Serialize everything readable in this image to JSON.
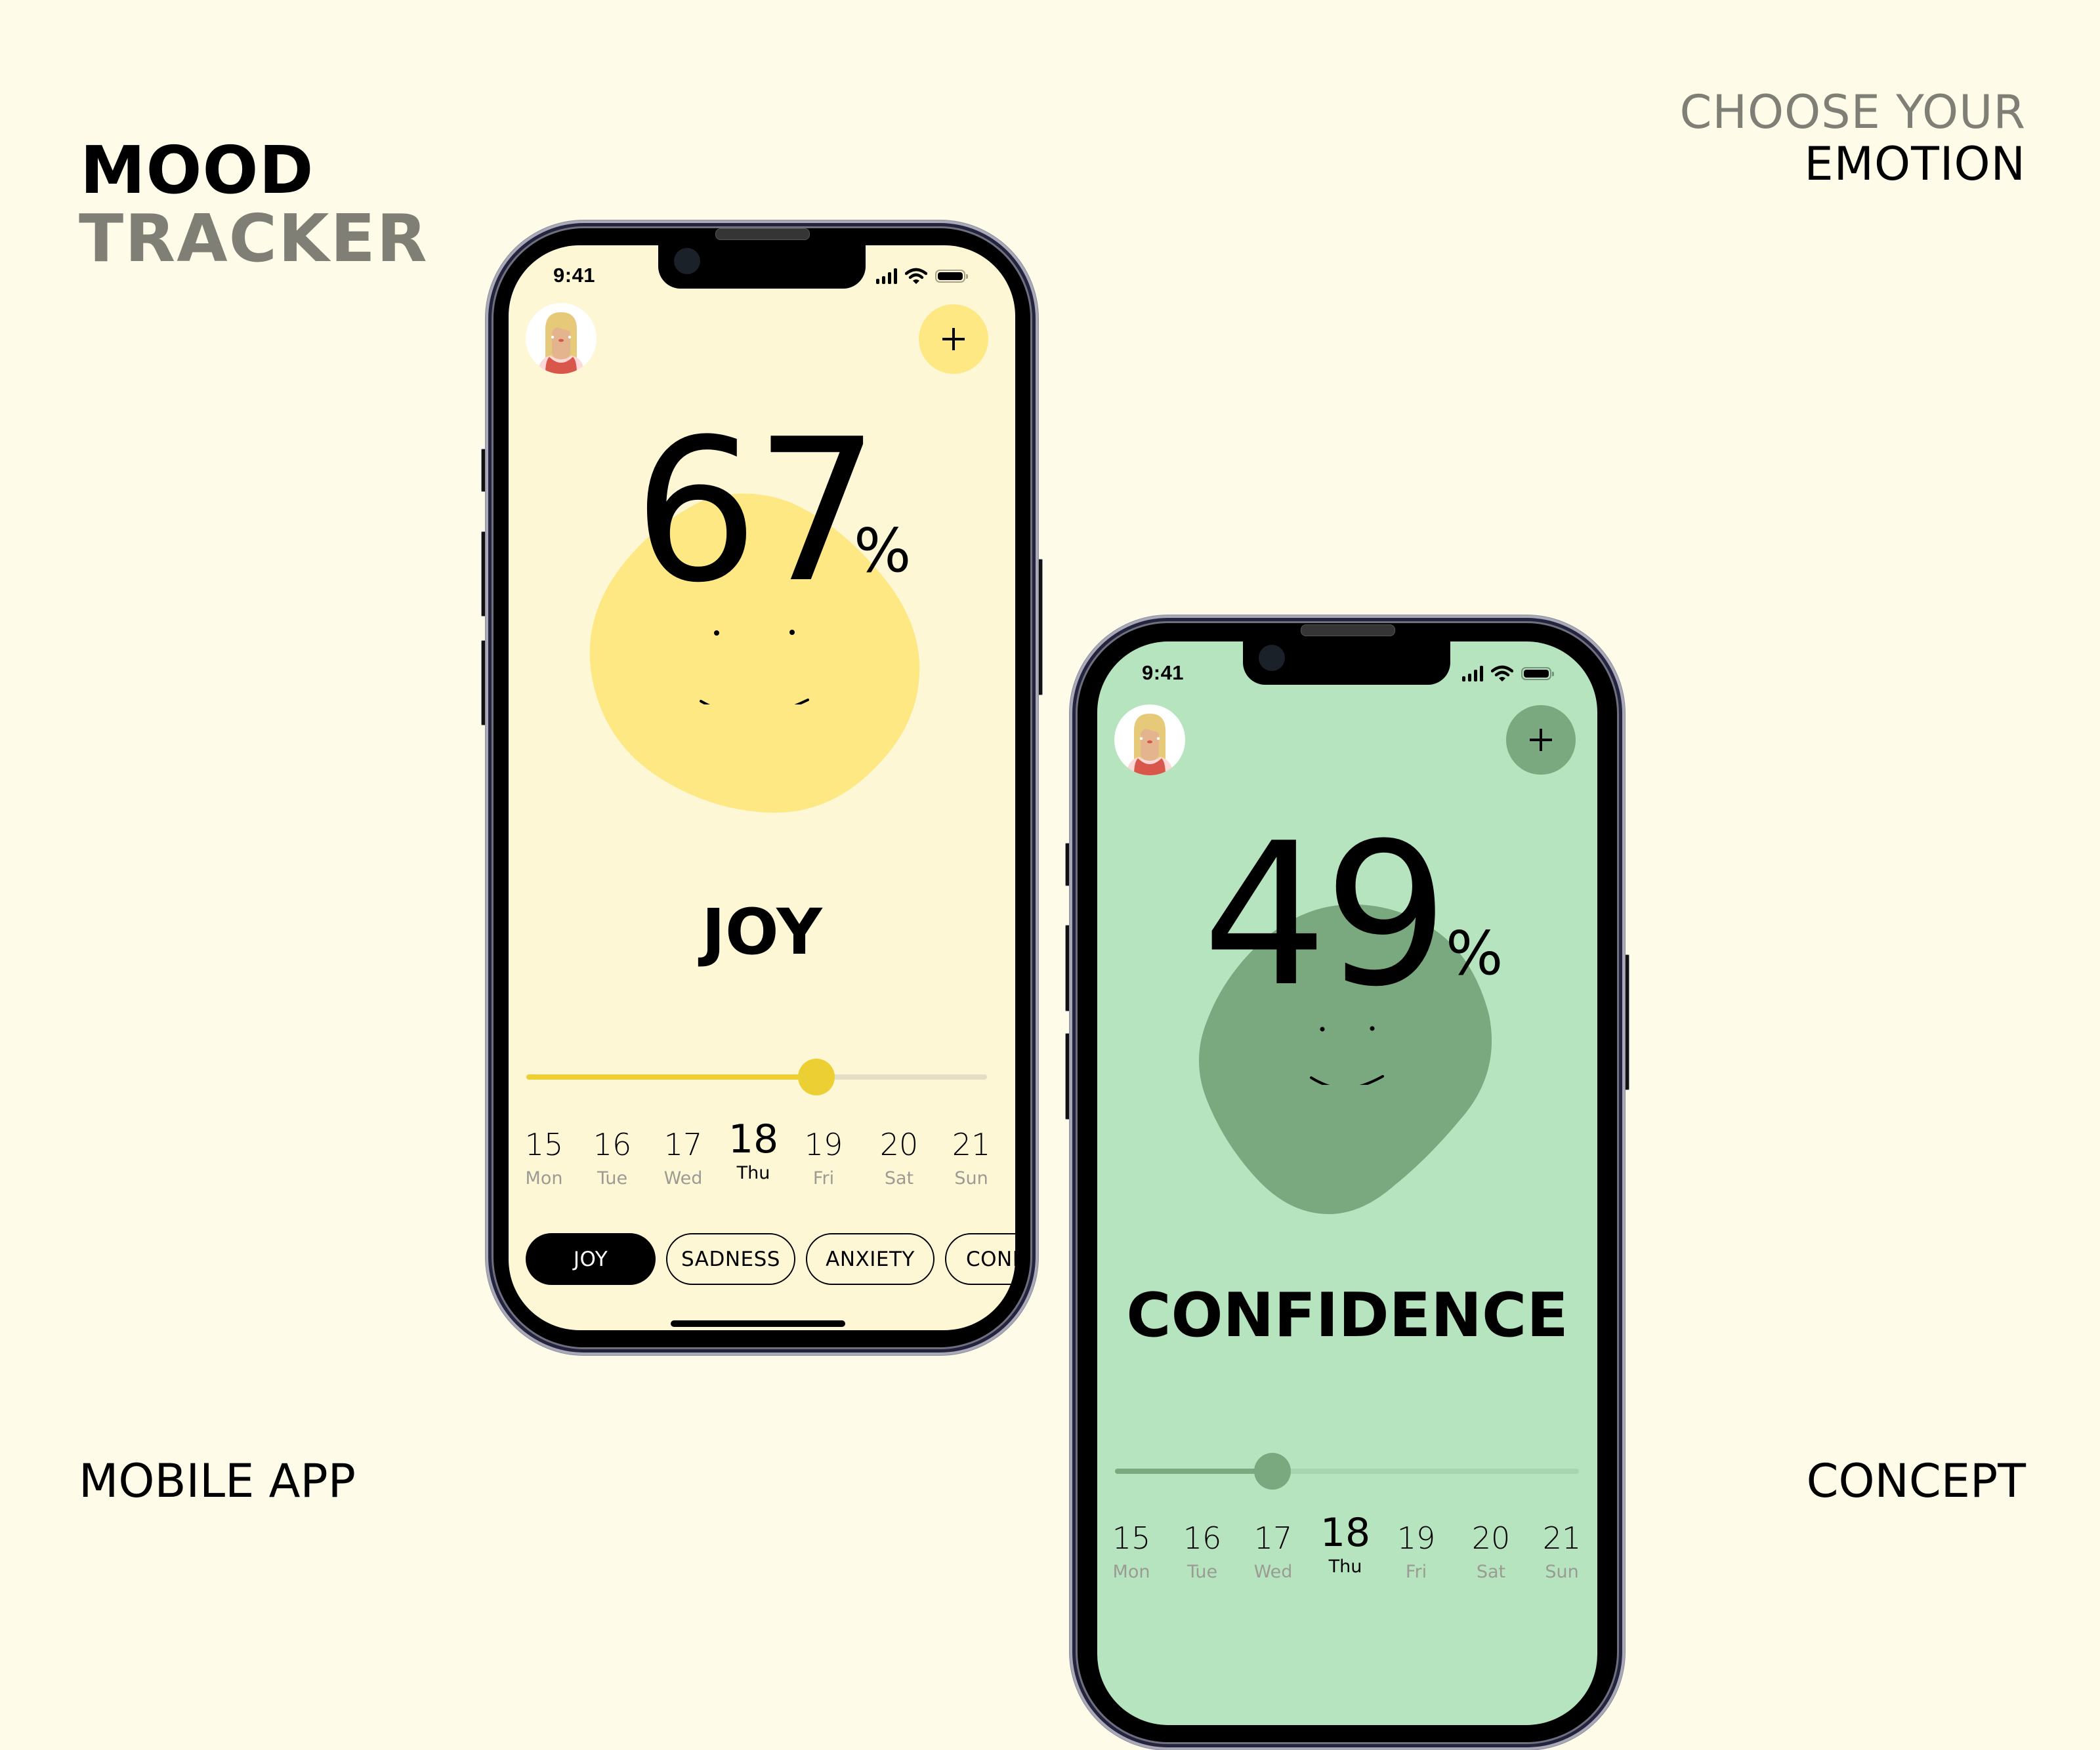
{
  "header": {
    "title_line1": "MOOD",
    "title_line2": "TRACKER",
    "tagline_line1": "CHOOSE YOUR",
    "tagline_line2": "EMOTION"
  },
  "footer": {
    "left": "MOBILE APP",
    "right": "CONCEPT"
  },
  "colors": {
    "background": "#fefbe9",
    "muted_text": "#7f7f76",
    "joy_screen": "#fef7d6",
    "joy_blob": "#fde884",
    "joy_accent": "#ecd033",
    "joy_track": "#e4dec4",
    "confidence_screen": "#b5e4bf",
    "confidence_blob": "#7aa87f",
    "confidence_accent": "#7aa87f",
    "confidence_track": "#a9d4b2"
  },
  "phones": [
    {
      "status": {
        "time": "9:41",
        "icons": [
          "signal-icon",
          "wifi-icon",
          "battery-icon"
        ]
      },
      "avatar_icon": "user-avatar",
      "add_icon": "plus-icon",
      "percentage": "67",
      "percent_sign": "%",
      "emotion": "JOY",
      "slider_value": 0.63,
      "dates": [
        {
          "num": "15",
          "day": "Mon",
          "active": false
        },
        {
          "num": "16",
          "day": "Tue",
          "active": false
        },
        {
          "num": "17",
          "day": "Wed",
          "active": false
        },
        {
          "num": "18",
          "day": "Thu",
          "active": true
        },
        {
          "num": "19",
          "day": "Fri",
          "active": false
        },
        {
          "num": "20",
          "day": "Sat",
          "active": false
        },
        {
          "num": "21",
          "day": "Sun",
          "active": false
        }
      ],
      "chips": [
        {
          "label": "JOY",
          "active": true
        },
        {
          "label": "SADNESS",
          "active": false
        },
        {
          "label": "ANXIETY",
          "active": false
        },
        {
          "label": "CONFIDENCE",
          "active": false
        }
      ]
    },
    {
      "status": {
        "time": "9:41",
        "icons": [
          "signal-icon",
          "wifi-icon",
          "battery-icon"
        ]
      },
      "avatar_icon": "user-avatar",
      "add_icon": "plus-icon",
      "percentage": "49",
      "percent_sign": "%",
      "emotion": "CONFIDENCE",
      "slider_value": 0.34,
      "dates": [
        {
          "num": "15",
          "day": "Mon",
          "active": false
        },
        {
          "num": "16",
          "day": "Tue",
          "active": false
        },
        {
          "num": "17",
          "day": "Wed",
          "active": false
        },
        {
          "num": "18",
          "day": "Thu",
          "active": true
        },
        {
          "num": "19",
          "day": "Fri",
          "active": false
        },
        {
          "num": "20",
          "day": "Sat",
          "active": false
        },
        {
          "num": "21",
          "day": "Sun",
          "active": false
        }
      ]
    }
  ]
}
